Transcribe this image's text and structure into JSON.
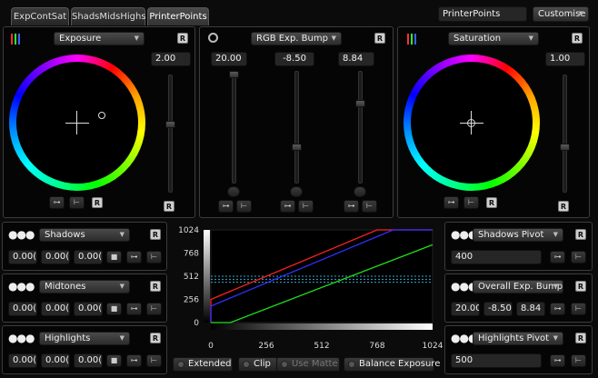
{
  "tabs": [
    {
      "label": "ExpContSat",
      "active": false
    },
    {
      "label": "ShadsMidsHighs",
      "active": false
    },
    {
      "label": "PrinterPoints",
      "active": true
    }
  ],
  "top_right": {
    "preset_field": "PrinterPoints",
    "customise_label": "Customise"
  },
  "left_wheel": {
    "mode": "Exposure",
    "value": "2.00"
  },
  "center_panel": {
    "mode": "RGB Exp. Bump",
    "values": [
      "20.00",
      "-8.50",
      "8.84"
    ]
  },
  "right_wheel": {
    "mode": "Saturation",
    "value": "1.00"
  },
  "bands": [
    {
      "label": "Shadows",
      "values": [
        "0.00(",
        "0.00(",
        "0.00("
      ]
    },
    {
      "label": "Midtones",
      "values": [
        "0.00(",
        "0.00(",
        "0.00("
      ]
    },
    {
      "label": "Highlights",
      "values": [
        "0.00(",
        "0.00(",
        "0.00("
      ]
    }
  ],
  "right_rows": [
    {
      "label": "Shadows Pivot",
      "values": [
        "400"
      ]
    },
    {
      "label": "Overall Exp. Bump",
      "values": [
        "20.00",
        "-8.50",
        "8.84"
      ]
    },
    {
      "label": "Highlights Pivot",
      "values": [
        "500"
      ]
    }
  ],
  "buttons": {
    "reset": "R",
    "extended": "Extended",
    "clip": "Clip",
    "use_matte": "Use Matte",
    "balance_exposure": "Balance Exposure"
  },
  "chart_data": {
    "type": "line",
    "xlim": [
      0,
      1024
    ],
    "ylim": [
      0,
      1024
    ],
    "xticks": [
      "0",
      "256",
      "512",
      "768",
      "1024"
    ],
    "yticks": [
      "0",
      "256",
      "512",
      "768",
      "1024"
    ],
    "series": [
      {
        "color": "#ff2020",
        "x": [
          0,
          0,
          768,
          1024
        ],
        "y": [
          0,
          256,
          1024,
          1024
        ]
      },
      {
        "color": "#3030ff",
        "x": [
          0,
          0,
          842,
          1024
        ],
        "y": [
          0,
          182,
          1024,
          1024
        ]
      },
      {
        "color": "#20e020",
        "x": [
          0,
          90,
          1024
        ],
        "y": [
          0,
          0,
          860
        ]
      }
    ],
    "reference_lines": [
      512,
      478,
      446
    ]
  },
  "colors": {
    "accent": "#ffffff",
    "panel_border": "#3c3c3c"
  }
}
